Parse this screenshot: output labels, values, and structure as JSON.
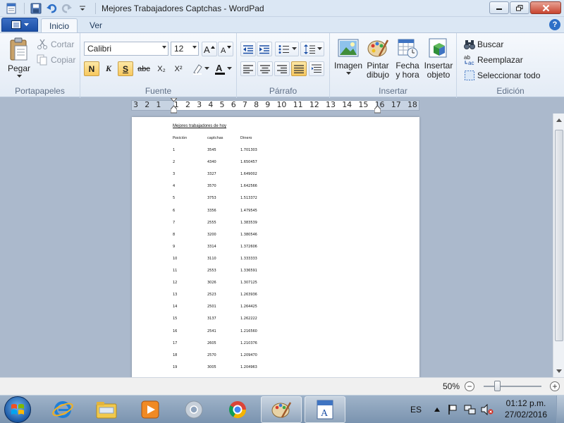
{
  "window": {
    "title": "Mejores Trabajadores Captchas - WordPad"
  },
  "tabs": {
    "inicio": "Inicio",
    "ver": "Ver"
  },
  "ribbon": {
    "portapapeles": {
      "label": "Portapapeles",
      "pegar": "Pegar",
      "cortar": "Cortar",
      "copiar": "Copiar"
    },
    "fuente": {
      "label": "Fuente",
      "font_name": "Calibri",
      "font_size": "12",
      "bold": "N",
      "italic": "K",
      "underline": "S",
      "strike": "abc",
      "subscript": "X₂",
      "superscript": "X²"
    },
    "parrafo": {
      "label": "Párrafo"
    },
    "insertar": {
      "label": "Insertar",
      "imagen": "Imagen",
      "pintar_1": "Pintar",
      "pintar_2": "dibujo",
      "fecha_1": "Fecha",
      "fecha_2": "y hora",
      "objeto_1": "Insertar",
      "objeto_2": "objeto"
    },
    "edicion": {
      "label": "Edición",
      "buscar": "Buscar",
      "reemplazar": "Reemplazar",
      "seleccionar": "Seleccionar todo"
    }
  },
  "ruler": {
    "numbers": [
      "3",
      "2",
      "1",
      "",
      "1",
      "2",
      "3",
      "4",
      "5",
      "6",
      "7",
      "8",
      "9",
      "10",
      "11",
      "12",
      "13",
      "14",
      "15",
      "16",
      "17",
      "18"
    ]
  },
  "document": {
    "title": "Mejores trabajadores de hoy",
    "headers": [
      "Posición",
      "captchas",
      "Dinero"
    ],
    "rows": [
      [
        "1",
        "3545",
        "1.701303"
      ],
      [
        "2",
        "4340",
        "1.650457"
      ],
      [
        "3",
        "3327",
        "1.649002"
      ],
      [
        "4",
        "3570",
        "1.642566"
      ],
      [
        "5",
        "3753",
        "1.513372"
      ],
      [
        "6",
        "3356",
        "1.479545"
      ],
      [
        "7",
        "2555",
        "1.383539"
      ],
      [
        "8",
        "3200",
        "1.380546"
      ],
      [
        "9",
        "3314",
        "1.372606"
      ],
      [
        "10",
        "3110",
        "1.333333"
      ],
      [
        "11",
        "2553",
        "1.336591"
      ],
      [
        "12",
        "3026",
        "1.307125"
      ],
      [
        "13",
        "2523",
        "1.263936"
      ],
      [
        "14",
        "2501",
        "1.264425"
      ],
      [
        "15",
        "3137",
        "1.262222"
      ],
      [
        "16",
        "2541",
        "1.216560"
      ],
      [
        "17",
        "2605",
        "1.210376"
      ],
      [
        "18",
        "2570",
        "1.209470"
      ],
      [
        "19",
        "3005",
        "1.204963"
      ]
    ]
  },
  "statusbar": {
    "zoom": "50%",
    "zoom_level": 0.2
  },
  "taskbar": {
    "language": "ES",
    "time": "01:12 p.m.",
    "date": "27/02/2016"
  },
  "colors": {
    "accent": "#1b4fa6",
    "ribbon_bg": "#e3ebf5",
    "canvas_bg": "#abb9cc"
  }
}
